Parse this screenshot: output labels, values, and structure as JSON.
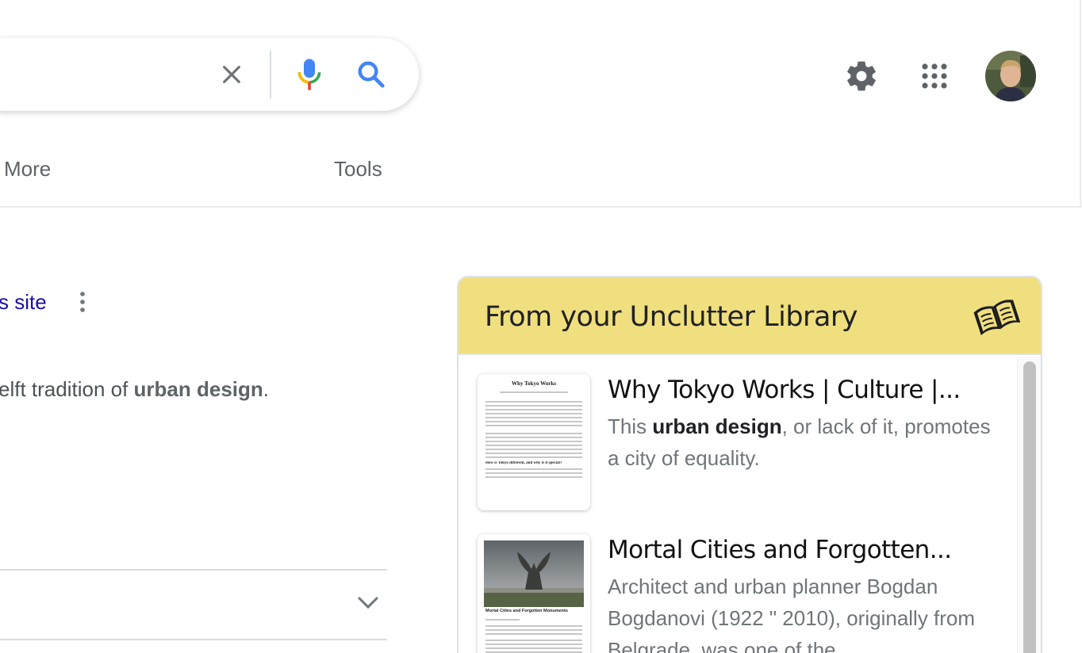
{
  "search": {
    "clear_icon": "close-icon",
    "mic_icon": "mic-icon",
    "search_icon": "search-icon"
  },
  "header": {
    "settings_icon": "gear-icon",
    "apps_icon": "apps-grid-icon",
    "avatar_icon": "user-avatar"
  },
  "tabs": {
    "more": "More",
    "tools": "Tools"
  },
  "result": {
    "site_link": "s site",
    "snippet_prefix": "elft tradition of ",
    "snippet_bold": "urban design",
    "snippet_suffix": "."
  },
  "unclutter": {
    "title": "From your Unclutter Library",
    "header_color": "#f0df7e",
    "articles": [
      {
        "title": "Why Tokyo Works | Culture |...",
        "excerpt_prefix": "This ",
        "excerpt_bold": "urban design",
        "excerpt_suffix": ", or lack of it, promotes a city of equality.",
        "thumb_heading": "Why Tokyo Works",
        "thumb_subheading": "How is Tokyo different, and why is it special?"
      },
      {
        "title": "Mortal Cities and Forgotten...",
        "excerpt": "Architect and urban planner Bogdan Bogdanovi (1922 \" 2010), originally from Belgrade, was one of the ...",
        "thumb_heading": "Mortal Cities and Forgotten Monuments"
      }
    ]
  },
  "colors": {
    "link": "#1a0dab",
    "google_blue": "#4285f4",
    "google_red": "#ea4335",
    "google_yellow": "#fbbc05",
    "google_green": "#34a853"
  }
}
